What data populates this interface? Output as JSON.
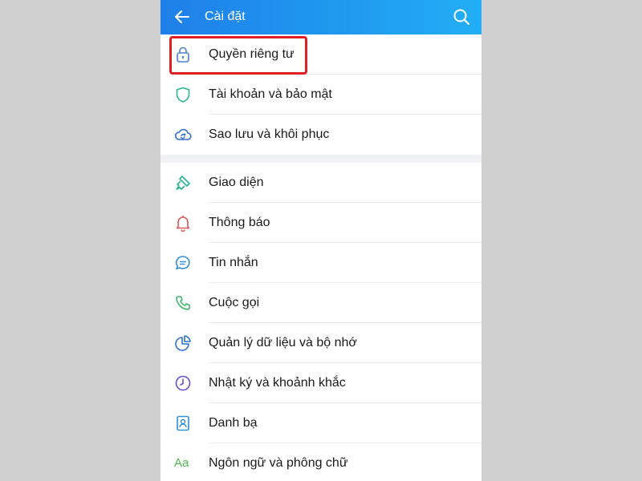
{
  "header": {
    "title": "Cài đặt"
  },
  "groups": [
    {
      "items": [
        {
          "label": "Quyền riêng tư",
          "icon": "lock-icon"
        },
        {
          "label": "Tài khoản và bảo mật",
          "icon": "shield-icon"
        },
        {
          "label": "Sao lưu và khôi phục",
          "icon": "cloud-sync-icon"
        }
      ]
    },
    {
      "items": [
        {
          "label": "Giao diện",
          "icon": "paint-brush-icon"
        },
        {
          "label": "Thông báo",
          "icon": "bell-icon"
        },
        {
          "label": "Tin nhắn",
          "icon": "chat-bubble-icon"
        },
        {
          "label": "Cuộc gọi",
          "icon": "phone-icon"
        },
        {
          "label": "Quản lý dữ liệu và bộ nhớ",
          "icon": "pie-chart-icon"
        },
        {
          "label": "Nhật ký và khoảnh khắc",
          "icon": "clock-icon"
        },
        {
          "label": "Danh bạ",
          "icon": "contact-card-icon"
        },
        {
          "label": "Ngôn ngữ và phông chữ",
          "icon": "font-aa-icon",
          "icon_text": "Aa"
        }
      ]
    }
  ],
  "colors": {
    "header_gradient_start": "#1f7fea",
    "header_gradient_end": "#23aef5",
    "highlight_border": "#e01f25"
  }
}
